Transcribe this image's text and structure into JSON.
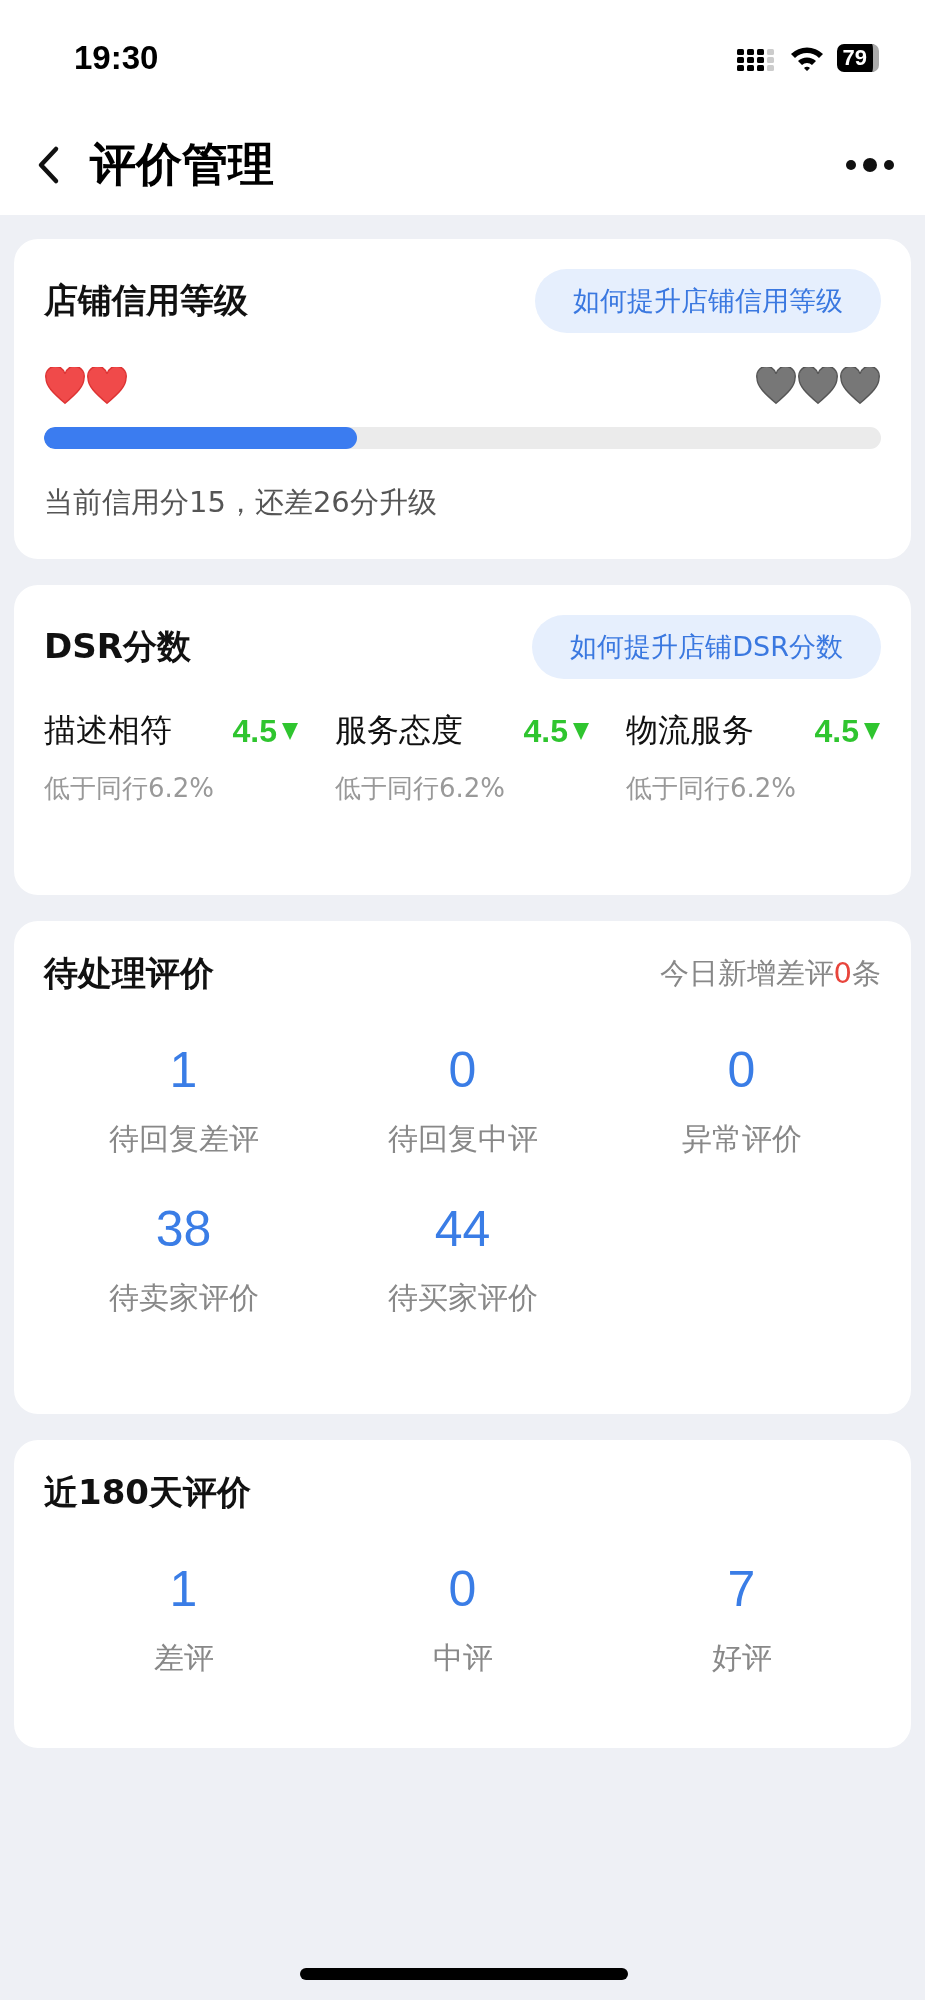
{
  "status_bar": {
    "time": "19:30",
    "battery": "79"
  },
  "header": {
    "title": "评价管理"
  },
  "credit": {
    "title": "店铺信用等级",
    "link": "如何提升店铺信用等级",
    "hearts": [
      {
        "filled": true
      },
      {
        "filled": true
      },
      {
        "filled": false
      },
      {
        "filled": false
      },
      {
        "filled": false
      }
    ],
    "level": 0.374,
    "note": "当前信用分15，还差26分升级"
  },
  "dsr": {
    "title": "DSR分数",
    "link": "如何提升店铺DSR分数",
    "items": [
      {
        "name": "描述相符",
        "score": "4.5",
        "falling": true,
        "compare": "低于同行6.2%"
      },
      {
        "name": "服务态度",
        "score": "4.5",
        "falling": true,
        "compare": "低于同行6.2%"
      },
      {
        "name": "物流服务",
        "score": "4.5",
        "falling": true,
        "compare": "低于同行6.2%"
      }
    ]
  },
  "pending": {
    "title": "待处理评价",
    "today": {
      "prefix": "今日新增差评",
      "count": "0",
      "suffix": "条"
    },
    "stats": [
      {
        "value": "1",
        "label": "待回复差评"
      },
      {
        "value": "0",
        "label": "待回复中评"
      },
      {
        "value": "0",
        "label": "异常评价"
      },
      {
        "value": "38",
        "label": "待卖家评价"
      },
      {
        "value": "44",
        "label": "待买家评价"
      }
    ]
  },
  "recent": {
    "title": "近180天评价",
    "stats": [
      {
        "value": "1",
        "label": "差评"
      },
      {
        "value": "0",
        "label": "中评"
      },
      {
        "value": "7",
        "label": "好评"
      }
    ]
  }
}
